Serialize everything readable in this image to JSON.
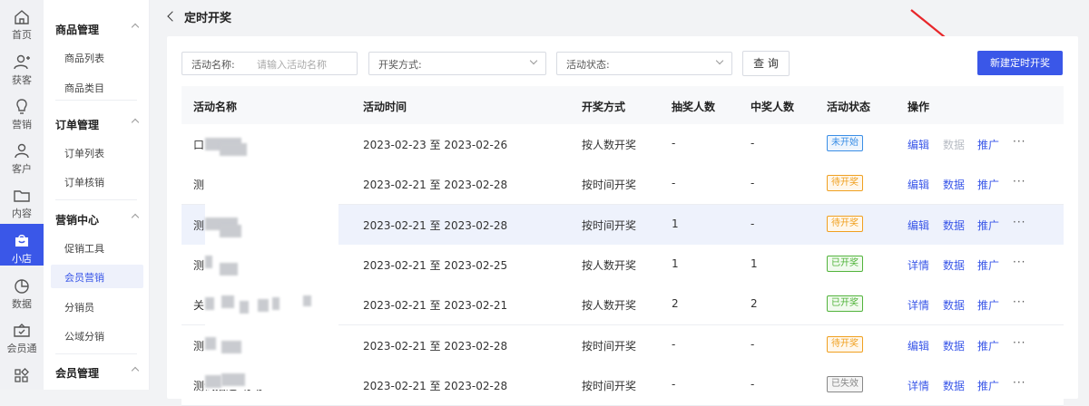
{
  "rail": [
    {
      "label": "首页",
      "icon": "home-icon"
    },
    {
      "label": "获客",
      "icon": "user-plus-icon"
    },
    {
      "label": "营销",
      "icon": "bulb-icon"
    },
    {
      "label": "客户",
      "icon": "user-icon"
    },
    {
      "label": "内容",
      "icon": "folder-icon"
    },
    {
      "label": "小店",
      "icon": "shop-icon"
    },
    {
      "label": "数据",
      "icon": "pie-chart-icon"
    },
    {
      "label": "会员通",
      "icon": "member-card-icon"
    },
    {
      "label": "",
      "icon": "grid-icon"
    }
  ],
  "menu": {
    "groups": [
      {
        "label": "商品管理",
        "items": [
          "商品列表",
          "商品类目"
        ]
      },
      {
        "label": "订单管理",
        "items": [
          "订单列表",
          "订单核销"
        ]
      },
      {
        "label": "营销中心",
        "items": [
          "促销工具",
          "会员营销",
          "分销员",
          "公域分销"
        ]
      },
      {
        "label": "会员管理",
        "items": []
      }
    ],
    "active_item": "会员营销"
  },
  "page": {
    "title": "定时开奖"
  },
  "filters": {
    "name_label": "活动名称:",
    "name_placeholder": "请输入活动名称",
    "method_label": "开奖方式:",
    "status_label": "活动状态:",
    "query_button": "查 询",
    "new_button": "新建定时开奖"
  },
  "table": {
    "headers": [
      "活动名称",
      "活动时间",
      "开奖方式",
      "抽奖人数",
      "中奖人数",
      "活动状态",
      "操作"
    ],
    "rows": [
      {
        "name": "口",
        "time": "2023-02-23 至 2023-02-26",
        "method": "按人数开奖",
        "participants": "-",
        "winners": "-",
        "status": "未开始",
        "status_kind": "blue",
        "ops": [
          [
            "编辑",
            "on"
          ],
          [
            "数据",
            "off"
          ],
          [
            "推广",
            "on"
          ]
        ]
      },
      {
        "name": "测",
        "time": "2023-02-21 至 2023-02-28",
        "method": "按时间开奖",
        "participants": "-",
        "winners": "-",
        "status": "待开奖",
        "status_kind": "orange",
        "ops": [
          [
            "编辑",
            "on"
          ],
          [
            "数据",
            "on"
          ],
          [
            "推广",
            "on"
          ]
        ]
      },
      {
        "name": "测",
        "time": "2023-02-21 至 2023-02-28",
        "method": "按时间开奖",
        "participants": "1",
        "winners": "-",
        "status": "待开奖",
        "status_kind": "orange",
        "ops": [
          [
            "编辑",
            "on"
          ],
          [
            "数据",
            "on"
          ],
          [
            "推广",
            "on"
          ]
        ]
      },
      {
        "name": "测",
        "time": "2023-02-21 至 2023-02-25",
        "method": "按人数开奖",
        "participants": "1",
        "winners": "1",
        "status": "已开奖",
        "status_kind": "green",
        "ops": [
          [
            "详情",
            "on"
          ],
          [
            "数据",
            "on"
          ],
          [
            "推广",
            "on"
          ]
        ]
      },
      {
        "name": "关",
        "time": "2023-02-21 至 2023-02-21",
        "method": "按人数开奖",
        "participants": "2",
        "winners": "2",
        "status": "已开奖",
        "status_kind": "green",
        "ops": [
          [
            "详情",
            "on"
          ],
          [
            "数据",
            "on"
          ],
          [
            "推广",
            "on"
          ]
        ]
      },
      {
        "name": "测",
        "time": "2023-02-21 至 2023-02-28",
        "method": "按时间开奖",
        "participants": "-",
        "winners": "-",
        "status": "待开奖",
        "status_kind": "orange",
        "ops": [
          [
            "编辑",
            "on"
          ],
          [
            "数据",
            "on"
          ],
          [
            "推广",
            "on"
          ]
        ]
      },
      {
        "name": "测试描述-勿动",
        "time": "2023-02-21 至 2023-02-28",
        "method": "按时间开奖",
        "participants": "-",
        "winners": "-",
        "status": "已失效",
        "status_kind": "gray",
        "ops": [
          [
            "详情",
            "on"
          ],
          [
            "数据",
            "on"
          ],
          [
            "推广",
            "on"
          ]
        ]
      }
    ],
    "more": "···"
  },
  "colors": {
    "accent": "#3a57e8",
    "blue_tag": "#3a8ee6",
    "orange_tag": "#f0a020",
    "green_tag": "#52b43c",
    "gray_tag": "#888888",
    "arrow": "#e8262a"
  }
}
